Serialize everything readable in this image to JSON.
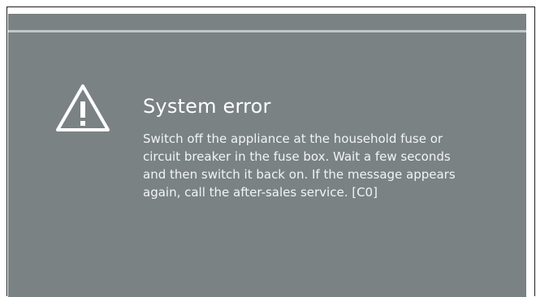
{
  "dialog": {
    "icon": "warning-triangle-icon",
    "title": "System error",
    "message_lines": [
      "Switch off the appliance at the household fuse or",
      "circuit breaker in the fuse box. Wait a few seconds",
      "and then switch it back on. If the message appears",
      "again, call the after-sales service. [C0]"
    ]
  },
  "colors": {
    "background": "#7a8283",
    "text": "#ffffff",
    "rule": "#c2c7c8"
  }
}
